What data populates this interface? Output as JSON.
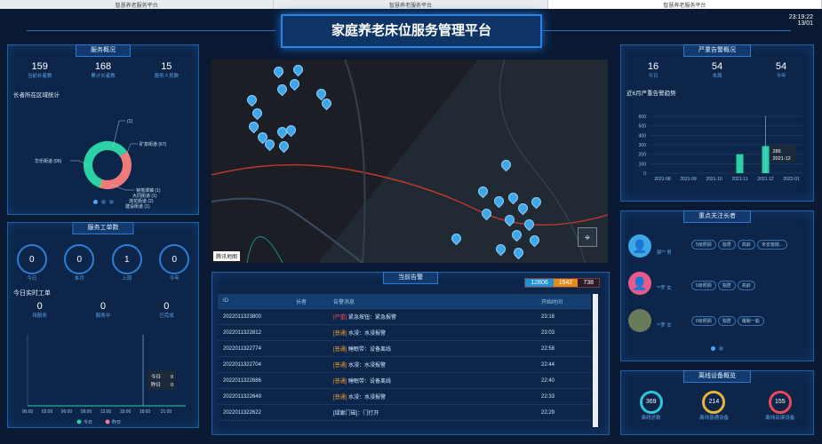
{
  "browser_tabs": [
    "智慧养老服务平台",
    "智慧养老服务平台",
    "智慧养老服务平台"
  ],
  "header": {
    "title": "家庭养老床位服务管理平台",
    "time": "23:19:22",
    "date": "13/01"
  },
  "service_overview": {
    "title": "服务概况",
    "stats": [
      {
        "value": "159",
        "label": "当前长者数"
      },
      {
        "value": "168",
        "label": "累计长者数"
      },
      {
        "value": "15",
        "label": "服务人员数"
      }
    ],
    "region_title": "长者所在区域统计",
    "donut_labels": [
      "(1)",
      "矿泉街道 (67)",
      "华乐街道 (95)",
      "钟落潭镇 (1)",
      "大同街道 (1)",
      "流花街道 (2)",
      "建设街道 (1)"
    ]
  },
  "work_orders": {
    "title": "服务工单数",
    "counts": [
      {
        "value": "0",
        "label": "今日"
      },
      {
        "value": "0",
        "label": "本月"
      },
      {
        "value": "1",
        "label": "上周"
      },
      {
        "value": "0",
        "label": "今年"
      }
    ],
    "today_title": "今日实时工单",
    "today": [
      {
        "value": "0",
        "label": "待服务"
      },
      {
        "value": "0",
        "label": "服务中"
      },
      {
        "value": "0",
        "label": "已完成"
      }
    ],
    "x_ticks": [
      "00:00",
      "03:00",
      "06:00",
      "09:00",
      "12:00",
      "15:00",
      "18:00",
      "21:00"
    ],
    "tooltip": [
      {
        "label": "今日",
        "value": "0"
      },
      {
        "label": "昨日",
        "value": "0"
      }
    ],
    "legend": [
      "今日",
      "昨日"
    ]
  },
  "map": {
    "label": "腾讯地图"
  },
  "alerts": {
    "title": "当前告警",
    "counts": [
      {
        "value": "12806",
        "color": "#1f8fd6"
      },
      {
        "value": "1542",
        "color": "#e28a1c"
      },
      {
        "value": "738",
        "color": "#c0392b"
      }
    ],
    "columns": [
      "ID",
      "长者",
      "告警消息",
      "开始时间"
    ],
    "rows": [
      {
        "id": "2022011323800",
        "level": "[严重]",
        "level_color": "#ff4d4d",
        "msg": "紧急按钮：紧急报警",
        "time": "23:18"
      },
      {
        "id": "2022011322812",
        "level": "[普通]",
        "level_color": "#f0a030",
        "msg": "水浸：水浸报警",
        "time": "23:03"
      },
      {
        "id": "2022011322774",
        "level": "[普通]",
        "level_color": "#f0a030",
        "msg": "睡眠带：设备离线",
        "time": "22:58"
      },
      {
        "id": "2022011322704",
        "level": "[普通]",
        "level_color": "#f0a030",
        "msg": "水浸：水浸报警",
        "time": "22:44"
      },
      {
        "id": "2022011322686",
        "level": "[普通]",
        "level_color": "#f0a030",
        "msg": "睡眠带：设备离线",
        "time": "22:40"
      },
      {
        "id": "2022011322649",
        "level": "[普通]",
        "level_color": "#f0a030",
        "msg": "水浸：水浸报警",
        "time": "22:33"
      },
      {
        "id": "2022011322622",
        "level": "",
        "level_color": "#f0a030",
        "msg": "[绿廊门磁]：门打开",
        "time": "22:29"
      }
    ]
  },
  "serious_alerts": {
    "title": "严重告警概况",
    "stats": [
      {
        "value": "16",
        "label": "今日"
      },
      {
        "value": "54",
        "label": "本周"
      },
      {
        "value": "54",
        "label": "今年"
      }
    ],
    "trend_title": "近6月严重告警趋势",
    "tooltip": [
      "286",
      "2021-12"
    ]
  },
  "chart_data": {
    "type": "bar",
    "title": "近6月严重告警趋势",
    "categories": [
      "2021-08",
      "2021-09",
      "2021-10",
      "2021-11",
      "2021-12",
      "2022-01"
    ],
    "values": [
      0,
      0,
      0,
      200,
      286,
      0
    ],
    "ylim": [
      0,
      600
    ],
    "yticks": [
      "600",
      "500",
      "400",
      "300",
      "200",
      "100",
      "0"
    ]
  },
  "focus_elders": {
    "title": "重点关注长者",
    "elders": [
      {
        "name": "郝** 男",
        "tags": [
          "5级照顾",
          "独居",
          "高龄",
          "未安装摄..."
        ],
        "avatar": "#3fa7e8"
      },
      {
        "name": "**罗 女",
        "tags": [
          "5级照顾",
          "独居",
          "高龄"
        ],
        "avatar": "#e85a8c"
      },
      {
        "name": "**罗 女",
        "tags": [
          "6级照顾",
          "独居",
          "睡眠一般"
        ],
        "avatar": "#6a7b5a"
      }
    ]
  },
  "offline_devices": {
    "title": "离线设备概览",
    "items": [
      {
        "value": "369",
        "label": "离线总数",
        "color": "#2dc7d9"
      },
      {
        "value": "214",
        "label": "离线普通设备",
        "color": "#e8b43a"
      },
      {
        "value": "155",
        "label": "离线关键设备",
        "color": "#e84a5a"
      }
    ]
  }
}
